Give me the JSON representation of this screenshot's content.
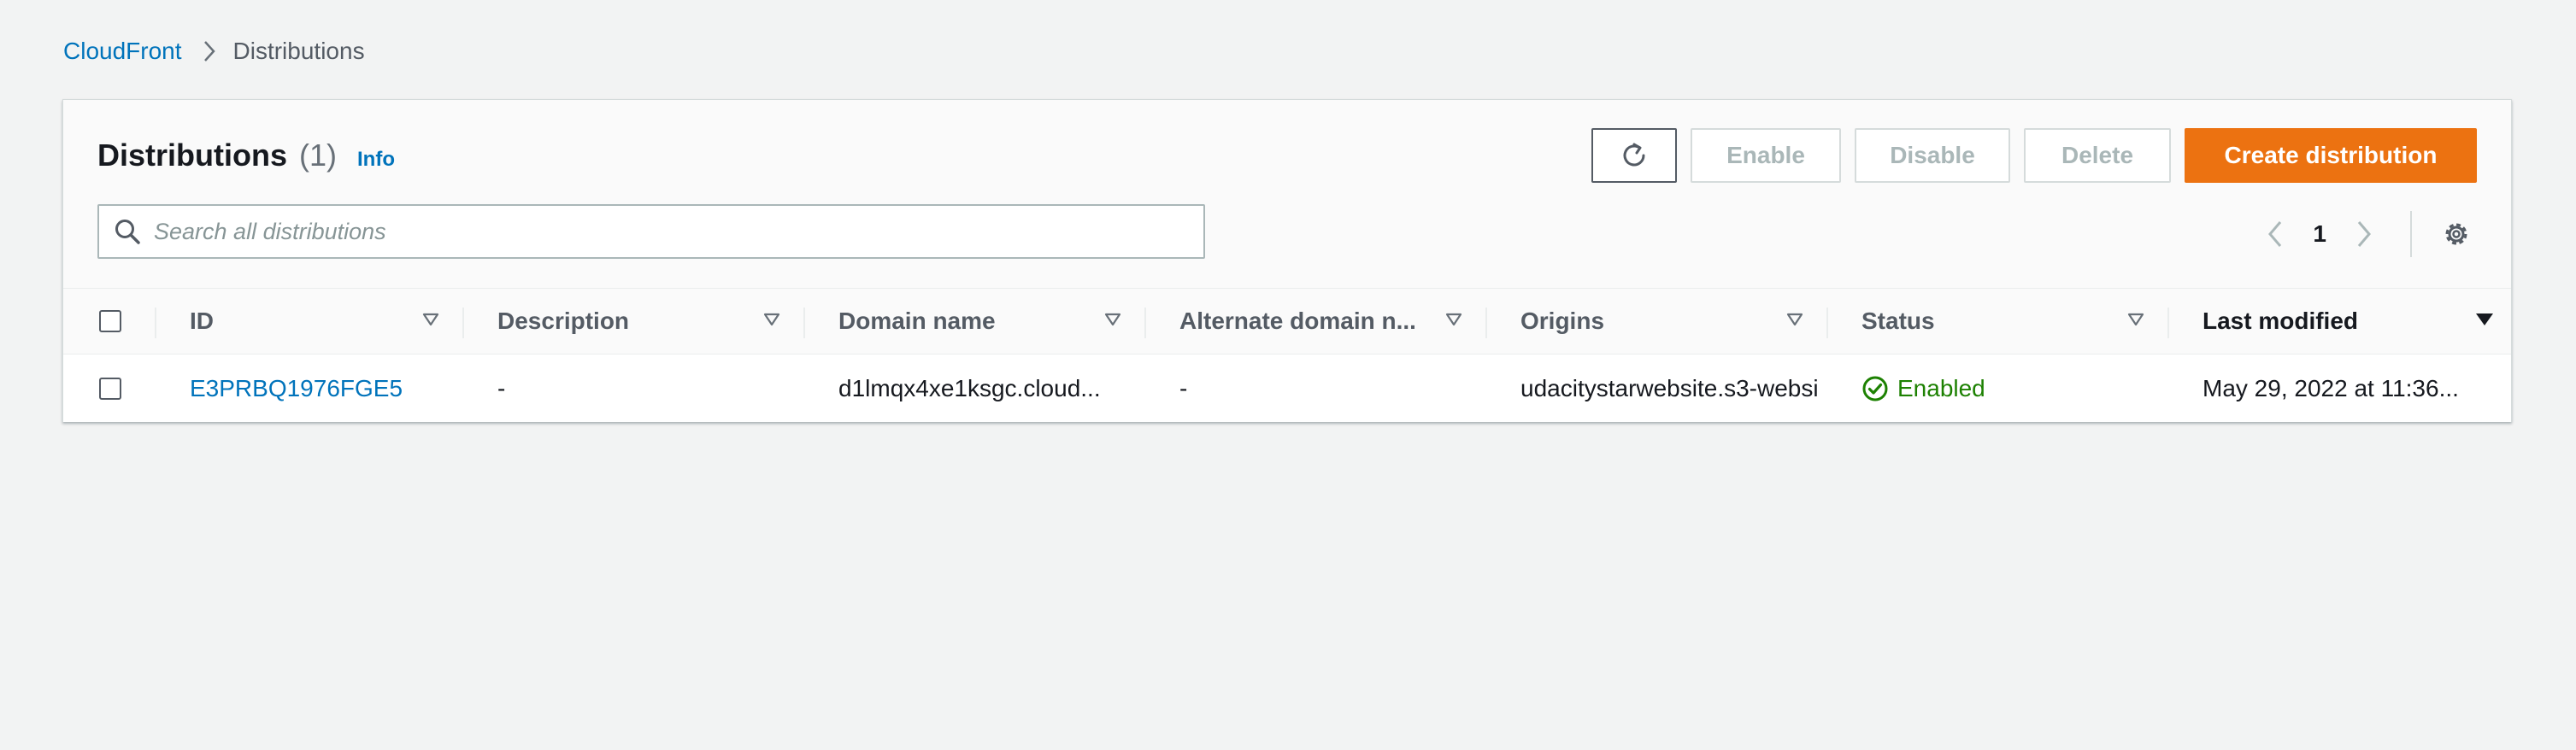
{
  "breadcrumb": {
    "root": "CloudFront",
    "current": "Distributions"
  },
  "panel": {
    "title": "Distributions",
    "count": "(1)",
    "info": "Info"
  },
  "actions": {
    "enable": "Enable",
    "disable": "Disable",
    "delete": "Delete",
    "create": "Create distribution"
  },
  "search": {
    "placeholder": "Search all distributions",
    "value": ""
  },
  "pagination": {
    "current_page": "1"
  },
  "table": {
    "columns": [
      "ID",
      "Description",
      "Domain name",
      "Alternate domain n...",
      "Origins",
      "Status",
      "Last modified"
    ],
    "rows": [
      {
        "id": "E3PRBQ1976FGE5",
        "description": "-",
        "domain_name": "d1lmqx4xe1ksgc.cloud...",
        "alternate_domain": "-",
        "origins": "udacitystarwebsite.s3-websi",
        "status": "Enabled",
        "last_modified": "May 29, 2022 at 11:36..."
      }
    ]
  },
  "colors": {
    "link": "#0073bb",
    "primary": "#ec7211",
    "success": "#1d8102",
    "background": "#f2f3f3"
  }
}
